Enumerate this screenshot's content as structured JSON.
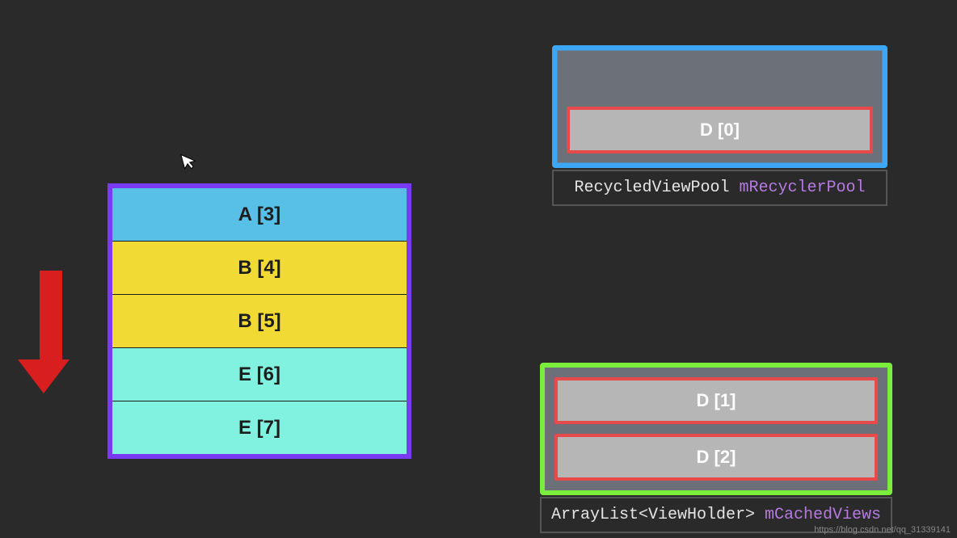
{
  "list": {
    "rows": [
      {
        "label": "A [3]",
        "color": "row-blue"
      },
      {
        "label": "B [4]",
        "color": "row-yellow"
      },
      {
        "label": "B [5]",
        "color": "row-yellow"
      },
      {
        "label": "E [6]",
        "color": "row-mint"
      },
      {
        "label": "E [7]",
        "color": "row-mint"
      }
    ]
  },
  "pool": {
    "items": [
      "D [0]"
    ],
    "label_class": "RecycledViewPool",
    "label_var": "mRecyclerPool"
  },
  "cache": {
    "items": [
      "D [1]",
      "D [2]"
    ],
    "label_class": "ArrayList<ViewHolder>",
    "label_var": "mCachedViews"
  },
  "watermark": "https://blog.csdn.net/qq_31339141"
}
